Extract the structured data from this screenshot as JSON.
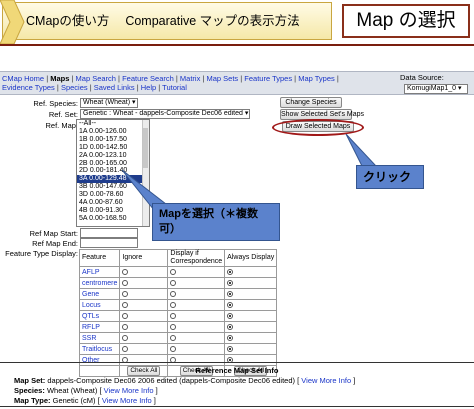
{
  "slide": {
    "title": "CMapの使い方　 Comparative マップの表示方法",
    "header": "Map の選択"
  },
  "nav": {
    "items": [
      "CMap Home",
      "Maps",
      "Map Search",
      "Feature Search",
      "Matrix",
      "Map Sets",
      "Feature Types",
      "Map Types",
      "Evidence Types",
      "Species",
      "Saved Links",
      "Help",
      "Tutorial"
    ],
    "data_source_label": "Data Source:",
    "data_source_value": "KomugiMap1_0"
  },
  "form": {
    "ref_species_label": "Ref. Species:",
    "ref_species_value": "Wheat (Wheat)",
    "ref_set_label": "Ref. Set:",
    "ref_set_value": "Genetic : Wheat - dappels-Composite Dec06 edited",
    "ref_map_label": "Ref. Map:",
    "change_species_button": "Change Species",
    "show_selected_button": "Show Selected Set's Maps",
    "draw_selected_button": "Draw Selected Maps",
    "map_items": [
      "--All--",
      "1A 0.00-126.00",
      "1B 0.00-157.50",
      "1D 0.00-142.50",
      "2A 0.00-123.10",
      "2B 0.00-165.00",
      "2D 0.00-181.40",
      "3A 0.00-129.48",
      "3B 0.00-147.60",
      "3D 0.00-78.60",
      "4A 0.00-87.60",
      "4B 0.00-91.30",
      "5A 0.00-168.50"
    ],
    "selected_map_index": 7,
    "ref_map_start_label": "Ref Map Start:",
    "ref_map_end_label": "Ref Map End:",
    "feature_type_display_label": "Feature Type Display:"
  },
  "feature_table": {
    "headers": [
      "Feature",
      "Ignore",
      "Display if Correspondence",
      "Always Display"
    ],
    "rows": [
      {
        "name": "AFLP",
        "choice": 2
      },
      {
        "name": "centromere",
        "choice": 2
      },
      {
        "name": "Gene",
        "choice": 2
      },
      {
        "name": "Locus",
        "choice": 2
      },
      {
        "name": "QTLs",
        "choice": 2
      },
      {
        "name": "RFLP",
        "choice": 2
      },
      {
        "name": "SSR",
        "choice": 2
      },
      {
        "name": "Traitlocus",
        "choice": 2
      },
      {
        "name": "Other",
        "choice": 2
      }
    ],
    "check_all_label": "Check All"
  },
  "annotations": {
    "click": "クリック",
    "select_line1": "Mapを選択（＊複数",
    "select_line2": "可）",
    "accent": "#5b82cc"
  },
  "info": {
    "heading": "Reference Map Set Info",
    "map_set_label": "Map Set:",
    "map_set_value": "dappels-Composite Dec06 2006 edited (dappels-Composite Dec06 edited)",
    "species_label": "Species:",
    "species_value": "Wheat (Wheat)",
    "map_type_label": "Map Type:",
    "map_type_value": "Genetic (cM)",
    "view_more": "View More Info"
  }
}
